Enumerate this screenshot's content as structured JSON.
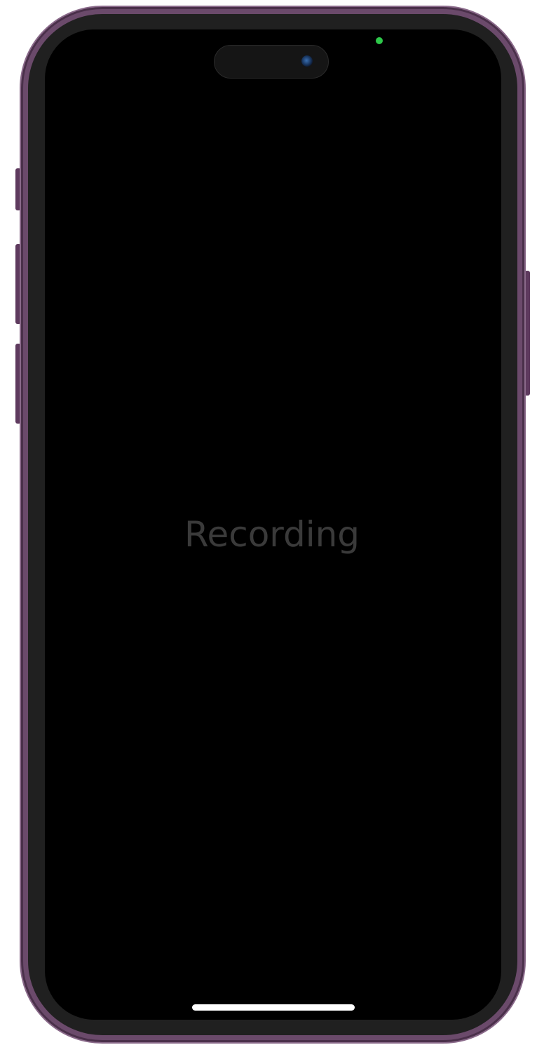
{
  "screen": {
    "center_label": "Recording",
    "background_color": "#000000",
    "label_color": "#3a3a3a"
  },
  "device": {
    "frame_color": "#6b4a6b",
    "bezel_color": "#202020",
    "privacy_indicator_color": "#2ec84a"
  },
  "icons": {
    "camera": "camera-lens-icon",
    "privacy_indicator": "recording-indicator-dot"
  }
}
